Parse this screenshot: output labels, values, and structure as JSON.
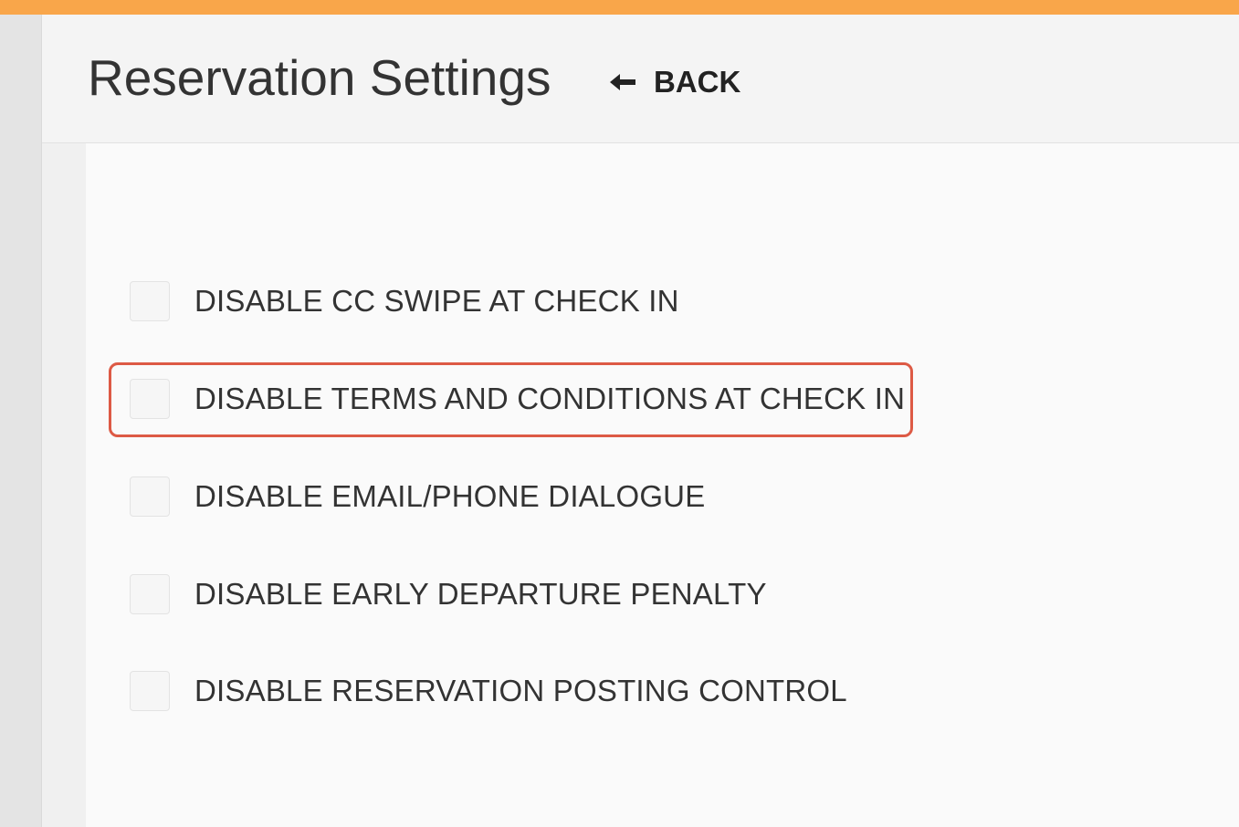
{
  "header": {
    "title": "Reservation Settings",
    "back_label": "BACK",
    "back_icon": "arrow-left-icon"
  },
  "colors": {
    "accent_bar": "#f9a64a",
    "highlight_border": "#dd5a45"
  },
  "settings": {
    "options": [
      {
        "label": "DISABLE CC SWIPE AT CHECK IN",
        "checked": false
      },
      {
        "label": "DISABLE TERMS AND CONDITIONS AT CHECK IN",
        "checked": false,
        "highlighted": true
      },
      {
        "label": "DISABLE EMAIL/PHONE DIALOGUE",
        "checked": false
      },
      {
        "label": "DISABLE EARLY DEPARTURE PENALTY",
        "checked": false
      },
      {
        "label": "DISABLE RESERVATION POSTING CONTROL",
        "checked": false
      }
    ]
  }
}
